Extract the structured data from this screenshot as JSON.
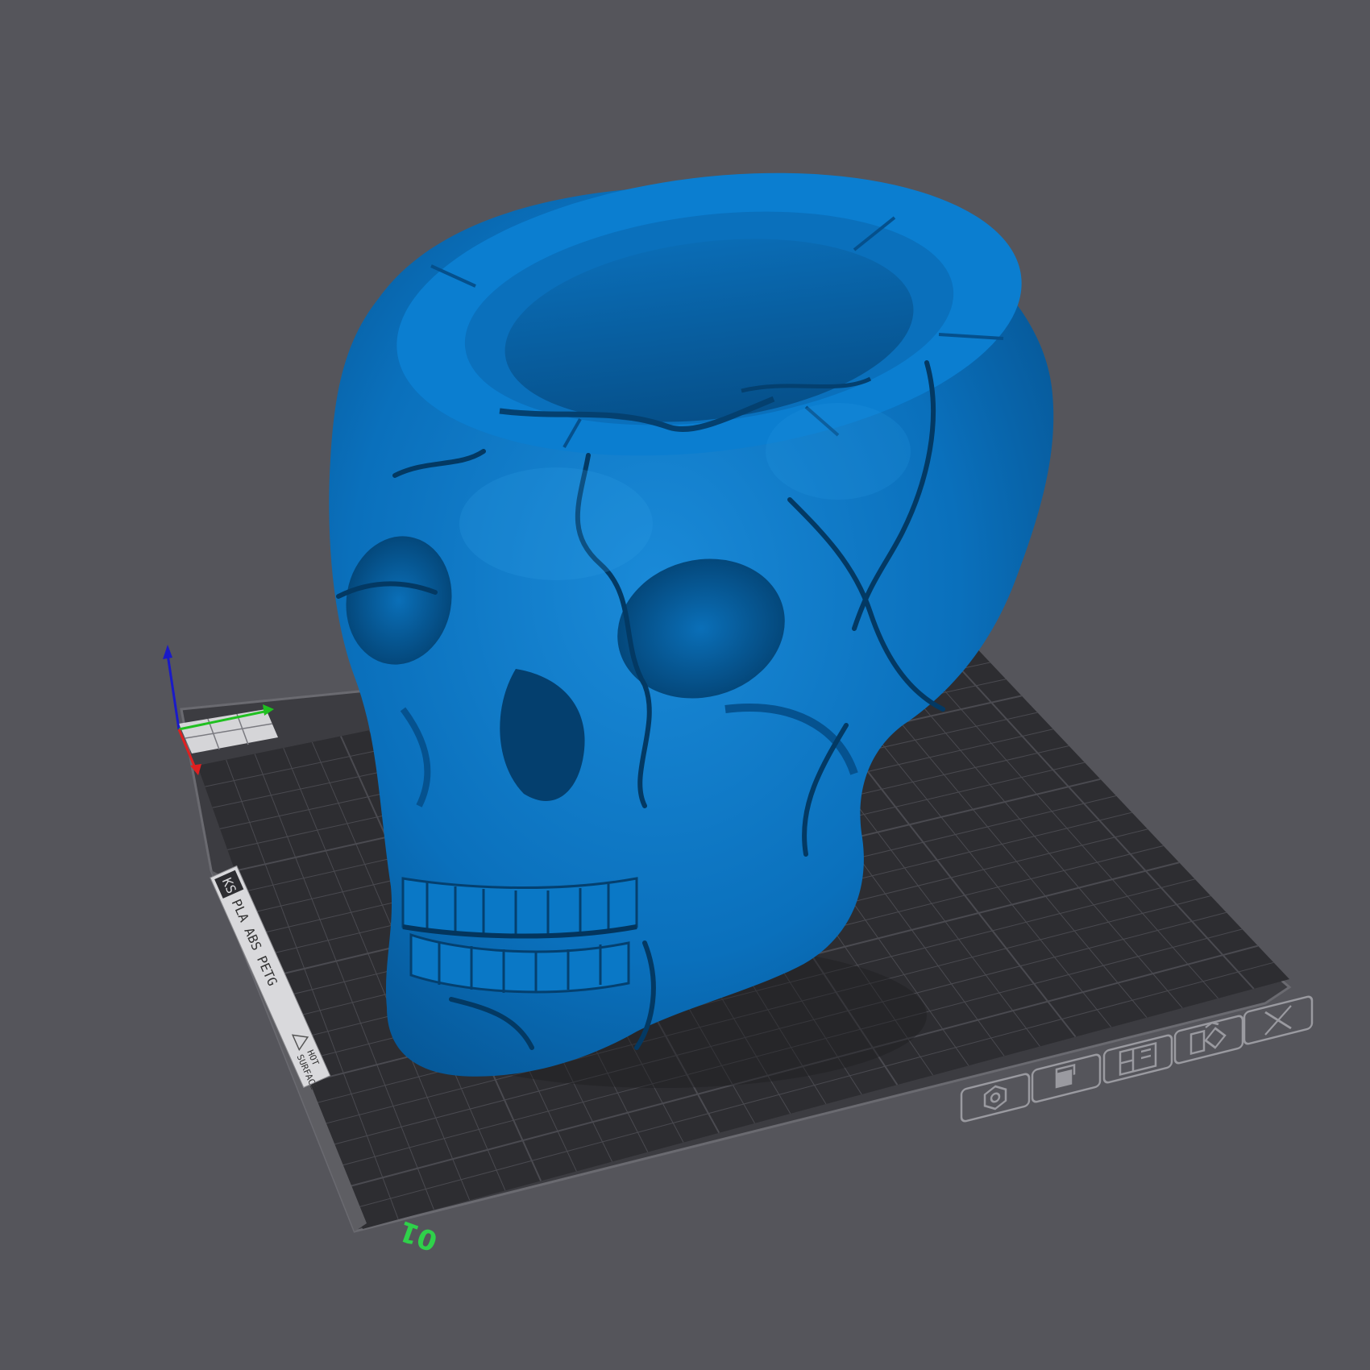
{
  "scene": {
    "background": "#55555b",
    "object": {
      "name": "skull",
      "color": "#0a78c8"
    }
  },
  "bed": {
    "sheet_brand": "KS",
    "materials_text": "PLA ABS PETG",
    "warning_text_1": "HOT",
    "warning_text_2": "SURFACE",
    "bed_number": "01",
    "surface_color": "#2d2d31",
    "grid_color": "#4a4a50",
    "edge_color": "#3a3a3f"
  },
  "axes": {
    "x_color": "#e02020",
    "y_color": "#20c020",
    "z_color": "#1a1ac8"
  },
  "toolbar": {
    "buttons": [
      {
        "icon": "settings-icon"
      },
      {
        "icon": "paint-icon"
      },
      {
        "icon": "layers-icon"
      },
      {
        "icon": "shapes-icon"
      },
      {
        "icon": "close-icon"
      }
    ]
  }
}
